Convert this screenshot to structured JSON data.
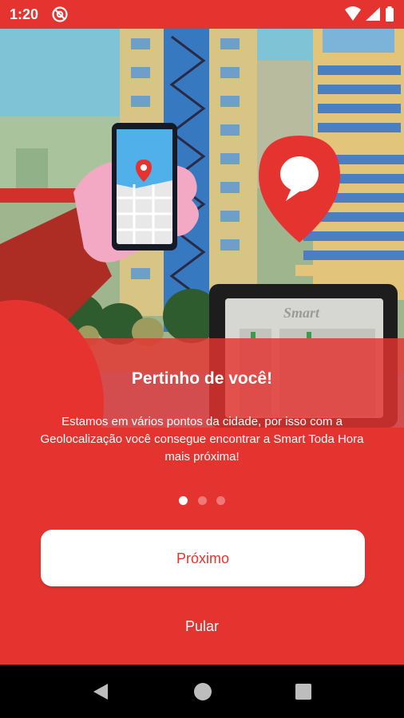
{
  "status_bar": {
    "time": "1:20",
    "icons": [
      "dnd-icon",
      "wifi-icon",
      "signal-icon",
      "battery-icon"
    ]
  },
  "illustration": {
    "kiosk_brand": "Smart",
    "icons": [
      "phone-map-icon",
      "location-pin-icon",
      "chat-bubble-icon"
    ]
  },
  "onboarding": {
    "title": "Pertinho de você!",
    "description": "Estamos em vários pontos da cidade, por isso com a Geolocalização você consegue encontrar a Smart Toda Hora mais próxima!",
    "page_count": 3,
    "current_page": 1
  },
  "actions": {
    "next_label": "Próximo",
    "skip_label": "Pular"
  },
  "colors": {
    "brand_red": "#e53330",
    "button_bg": "#ffffff"
  },
  "nav_bar": {
    "icons": [
      "back-icon",
      "home-icon",
      "recents-icon"
    ]
  }
}
